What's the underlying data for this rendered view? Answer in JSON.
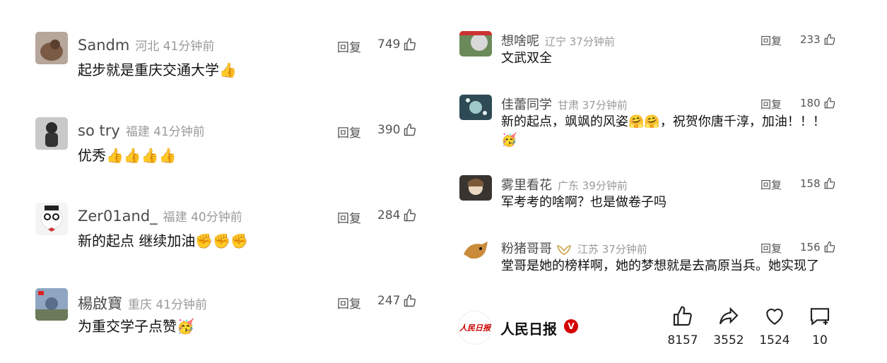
{
  "left_comments": [
    {
      "name": "Sandm",
      "meta": "河北 41分钟前",
      "text": "起步就是重庆交通大学👍",
      "reply": "回复",
      "likes": "749"
    },
    {
      "name": "so try",
      "meta": "福建 41分钟前",
      "text": "优秀👍👍👍👍",
      "reply": "回复",
      "likes": "390"
    },
    {
      "name": "Zer01and_",
      "meta": "福建 40分钟前",
      "text": "新的起点 继续加油✊✊✊",
      "reply": "回复",
      "likes": "284"
    },
    {
      "name": "楊啟寶",
      "meta": "重庆 41分钟前",
      "text": "为重交学子点赞🥳",
      "reply": "回复",
      "likes": "247"
    }
  ],
  "right_comments": [
    {
      "name": "想啥呢",
      "meta": "辽宁 37分钟前",
      "text": "文武双全",
      "reply": "回复",
      "likes": "233"
    },
    {
      "name": "佳蕾同学",
      "meta": "甘肃 37分钟前",
      "text": "新的起点，飒飒的风姿🤗🤗，祝贺你唐千淳，加油！！！🥳",
      "reply": "回复",
      "likes": "180"
    },
    {
      "name": "雾里看花",
      "meta": "广东 39分钟前",
      "text": "军考考的啥啊？也是做卷子吗",
      "reply": "回复",
      "likes": "158"
    },
    {
      "name": "粉猪哥哥",
      "meta": "江苏 37分钟前",
      "text": "堂哥是她的榜样啊，她的梦想就是去高原当兵。她实现了",
      "reply": "回复",
      "likes": "156"
    }
  ],
  "bottom_bar": {
    "brand_name": "人民日报",
    "verified": "V",
    "logo_text": "人民日报",
    "actions": [
      {
        "icon": "like-icon",
        "count": "8157"
      },
      {
        "icon": "share-icon",
        "count": "3552"
      },
      {
        "icon": "favorite-heart-icon",
        "count": "1524"
      },
      {
        "icon": "comment-icon",
        "count": "10"
      }
    ]
  },
  "colors": {
    "verified": "#d40000",
    "meta": "#9a9a9a",
    "text": "#111111"
  }
}
